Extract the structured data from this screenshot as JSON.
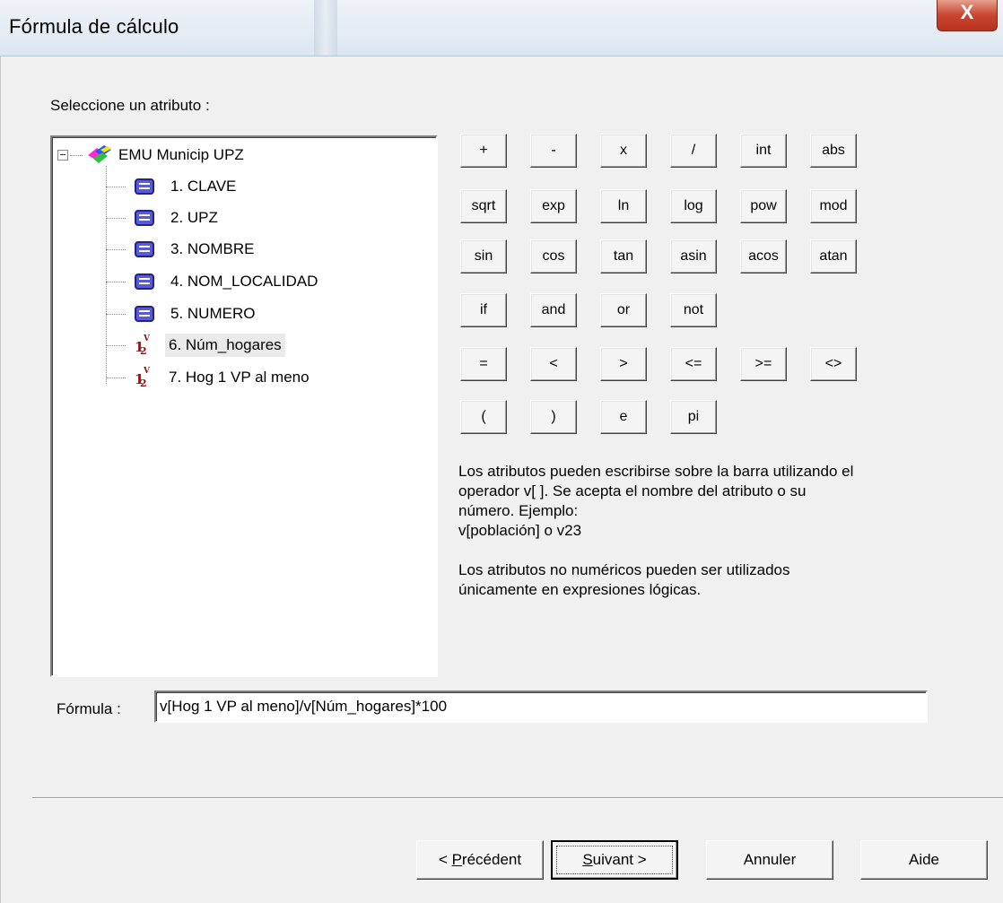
{
  "window": {
    "title": "Fórmula de cálculo",
    "close_glyph": "X"
  },
  "select_label": "Seleccione un atributo :",
  "tree": {
    "root_label": "EMU Municip UPZ",
    "root_icon": "layer-icon",
    "items": [
      {
        "label": "1. CLAVE",
        "icon": "text-attribute-icon"
      },
      {
        "label": "2. UPZ",
        "icon": "text-attribute-icon"
      },
      {
        "label": "3. NOMBRE",
        "icon": "text-attribute-icon"
      },
      {
        "label": "4. NOM_LOCALIDAD",
        "icon": "text-attribute-icon"
      },
      {
        "label": "5. NUMERO",
        "icon": "text-attribute-icon"
      },
      {
        "label": "6. Núm_hogares",
        "icon": "numeric-attribute-icon",
        "selected": true
      },
      {
        "label": "7. Hog 1 VP al meno",
        "icon": "numeric-attribute-icon"
      }
    ]
  },
  "operators": {
    "row1": [
      "+",
      "-",
      "x",
      "/",
      "int",
      "abs"
    ],
    "row2": [
      "sqrt",
      "exp",
      "ln",
      "log",
      "pow",
      "mod"
    ],
    "row3": [
      "sin",
      "cos",
      "tan",
      "asin",
      "acos",
      "atan"
    ],
    "row4": [
      "if",
      "and",
      "or",
      "not"
    ],
    "row5": [
      "=",
      "<",
      ">",
      "<=",
      ">=",
      "<>"
    ],
    "row6": [
      "(",
      ")",
      "e",
      "pi"
    ]
  },
  "help": {
    "p1_l1": "Los atributos pueden escribirse sobre la barra utilizando el",
    "p1_l2": "operador v[ ]. Se acepta el nombre del atributo o su",
    "p1_l3": "número. Ejemplo:",
    "p1_l4": "v[población] o v23",
    "p2_l1": "Los atributos no numéricos pueden ser utilizados",
    "p2_l2": "únicamente en expresiones lógicas."
  },
  "formula": {
    "label": "Fórmula :",
    "value": "v[Hog 1 VP al meno]/v[Núm_hogares]*100"
  },
  "buttons": {
    "previous_prefix": "< ",
    "previous_mnemonic": "P",
    "previous_rest": "récédent",
    "next_mnemonic": "S",
    "next_rest": "uivant >",
    "cancel": "Annuler",
    "help": "Aide"
  }
}
